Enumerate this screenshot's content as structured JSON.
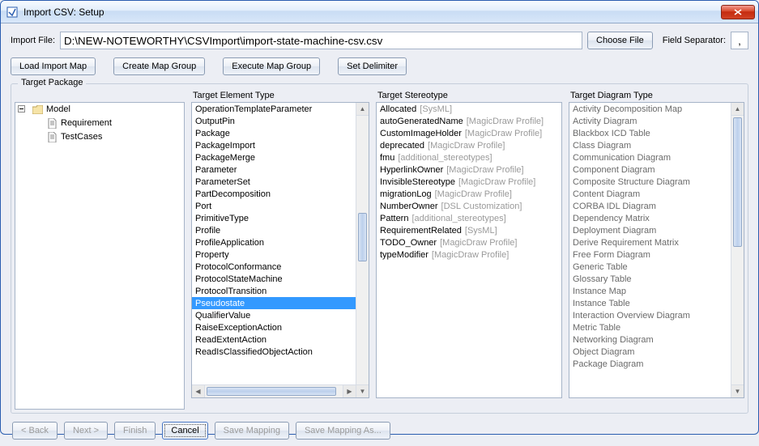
{
  "window": {
    "title": "Import CSV: Setup"
  },
  "import": {
    "file_label": "Import File:",
    "file_value": "D:\\NEW-NOTEWORTHY\\CSVImport\\import-state-machine-csv.csv",
    "choose_file": "Choose File",
    "separator_label": "Field Separator:",
    "separator_value": ","
  },
  "toolbar": {
    "load_map": "Load Import Map",
    "create_group": "Create Map Group",
    "execute_group": "Execute Map Group",
    "set_delimiter": "Set Delimiter"
  },
  "headers": {
    "package": "Target Package",
    "element_type": "Target Element Type",
    "stereotype": "Target Stereotype",
    "diagram_type": "Target Diagram Type"
  },
  "tree": {
    "root": "Model",
    "children": [
      "Requirement",
      "TestCases"
    ]
  },
  "element_types": [
    "OperationTemplateParameter",
    "OutputPin",
    "Package",
    "PackageImport",
    "PackageMerge",
    "Parameter",
    "ParameterSet",
    "PartDecomposition",
    "Port",
    "PrimitiveType",
    "Profile",
    "ProfileApplication",
    "Property",
    "ProtocolConformance",
    "ProtocolStateMachine",
    "ProtocolTransition",
    "Pseudostate",
    "QualifierValue",
    "RaiseExceptionAction",
    "ReadExtentAction",
    "ReadIsClassifiedObjectAction"
  ],
  "element_selected": "Pseudostate",
  "stereotypes": [
    {
      "name": "Allocated",
      "profile": "SysML"
    },
    {
      "name": "autoGeneratedName",
      "profile": "MagicDraw Profile"
    },
    {
      "name": "CustomImageHolder",
      "profile": "MagicDraw Profile"
    },
    {
      "name": "deprecated",
      "profile": "MagicDraw Profile"
    },
    {
      "name": "fmu",
      "profile": "additional_stereotypes"
    },
    {
      "name": "HyperlinkOwner",
      "profile": "MagicDraw Profile"
    },
    {
      "name": "InvisibleStereotype",
      "profile": "MagicDraw Profile"
    },
    {
      "name": "migrationLog",
      "profile": "MagicDraw Profile"
    },
    {
      "name": "NumberOwner",
      "profile": "DSL Customization"
    },
    {
      "name": "Pattern",
      "profile": "additional_stereotypes"
    },
    {
      "name": "RequirementRelated",
      "profile": "SysML"
    },
    {
      "name": "TODO_Owner",
      "profile": "MagicDraw Profile"
    },
    {
      "name": "typeModifier",
      "profile": "MagicDraw Profile"
    }
  ],
  "diagram_types": [
    "Activity Decomposition Map",
    "Activity Diagram",
    "Blackbox ICD Table",
    "Class Diagram",
    "Communication Diagram",
    "Component Diagram",
    "Composite Structure Diagram",
    "Content Diagram",
    "CORBA IDL Diagram",
    "Dependency Matrix",
    "Deployment Diagram",
    "Derive Requirement Matrix",
    "Free Form Diagram",
    "Generic Table",
    "Glossary Table",
    "Instance Map",
    "Instance Table",
    "Interaction Overview Diagram",
    "Metric Table",
    "Networking Diagram",
    "Object Diagram",
    "Package Diagram"
  ],
  "footer": {
    "back": "< Back",
    "next": "Next >",
    "finish": "Finish",
    "cancel": "Cancel",
    "save_mapping": "Save Mapping",
    "save_mapping_as": "Save Mapping As..."
  }
}
